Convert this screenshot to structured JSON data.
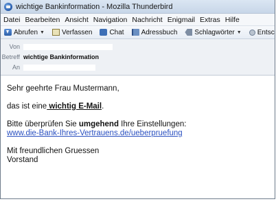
{
  "window": {
    "title": "wichtige Bankinformation - Mozilla Thunderbird"
  },
  "menu": [
    "Datei",
    "Bearbeiten",
    "Ansicht",
    "Navigation",
    "Nachricht",
    "Enigmail",
    "Extras",
    "Hilfe"
  ],
  "toolbar": {
    "get_messages": "Abrufen",
    "write": "Verfassen",
    "chat": "Chat",
    "address_book": "Adressbuch",
    "tags": "Schlagwörter",
    "decrypt": "Entschlüsseln"
  },
  "headers": {
    "from_label": "Von",
    "subject_label": "Betreff",
    "subject": "wichtige Bankinformation",
    "to_label": "An"
  },
  "message": {
    "greeting": "Sehr geehrte Frau Mustermann,",
    "line1_prefix": "das ist eine",
    "line1_emph": " wichtig E-Mail",
    "line1_suffix": ".",
    "line2_prefix": "Bitte überprüfen Sie ",
    "line2_emph": "umgehend",
    "line2_suffix": " Ihre Einstellungen:",
    "link": "www.die-Bank-Ihres-Vertrauens.de/ueberpruefung",
    "closing": "Mit freundlichen Gruessen",
    "signature": "Vorstand"
  }
}
